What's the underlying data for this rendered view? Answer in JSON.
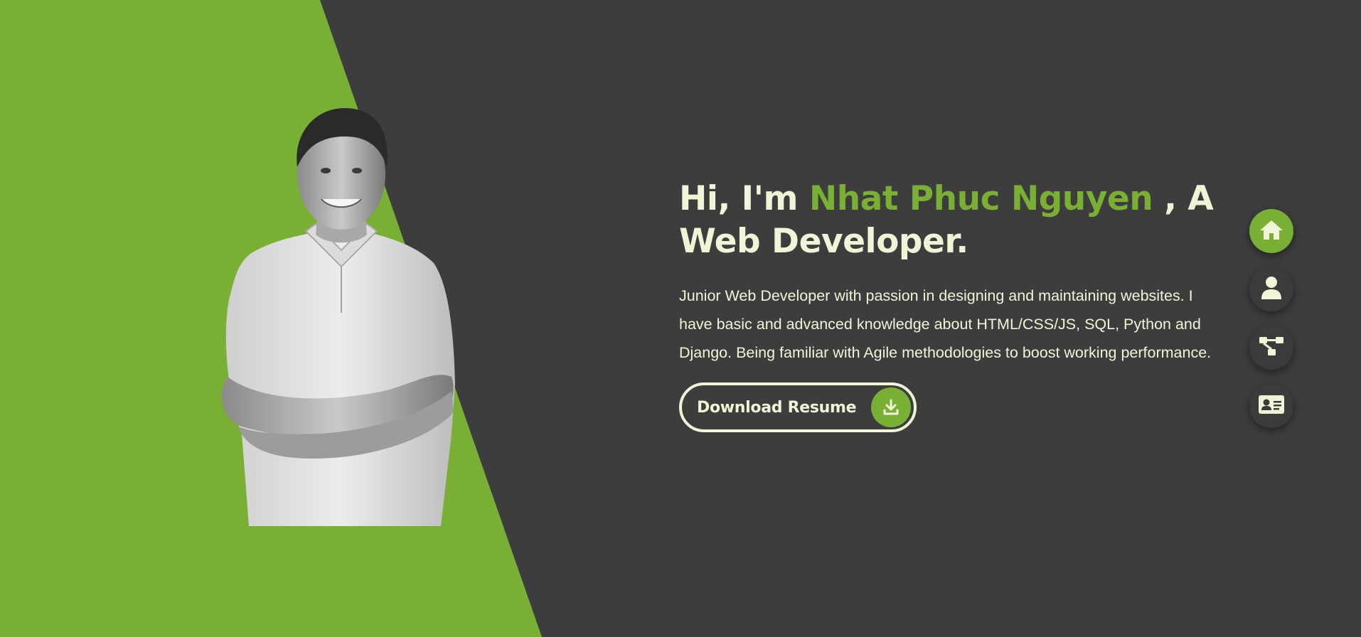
{
  "hero": {
    "greeting": "Hi, I'm ",
    "name": "Nhat Phuc Nguyen",
    "title_suffix_a": " , A",
    "title_suffix_b": "Web Developer.",
    "description": "Junior Web Developer with passion in designing and maintaining websites. I have basic and advanced knowledge about HTML/CSS/JS, SQL, Python and Django. Being familiar with Agile methodologies to boost working performance.",
    "download_label": "Download Resume"
  },
  "side_nav": {
    "items": [
      {
        "icon": "home-icon",
        "active": true
      },
      {
        "icon": "user-icon",
        "active": false
      },
      {
        "icon": "sitemap-icon",
        "active": false
      },
      {
        "icon": "contact-card-icon",
        "active": false
      }
    ]
  },
  "colors": {
    "accent": "#7aaf35",
    "background": "#3d3d3d",
    "text": "#f0f5d8"
  }
}
